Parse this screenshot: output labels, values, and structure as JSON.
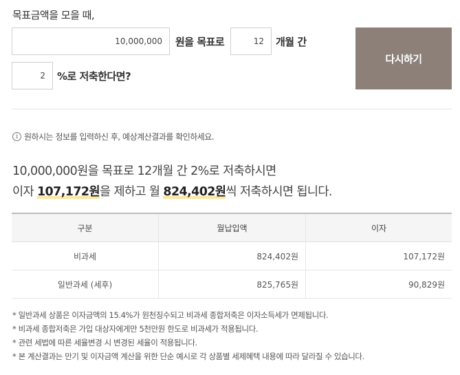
{
  "form": {
    "intro": "목표금액을 모을 때,",
    "amount_value": "10,000,000",
    "amount_suffix": "원을 목표로",
    "months_value": "12",
    "months_suffix": "개월 간",
    "rate_value": "2",
    "rate_suffix": "%로 저축한다면?",
    "recalc_label": "다시하기"
  },
  "notice": "원하시는 정보를 입력하신 후, 예상계산결과를 확인하세요.",
  "result": {
    "line1": "10,000,000원을 목표로 12개월 간 2%로 저축하시면",
    "line2_pre": "이자 ",
    "interest": "107,172원",
    "line2_mid": "을 제하고 월 ",
    "monthly": "824,402원",
    "line2_post": "씩 저축하시면 됩니다."
  },
  "table": {
    "headers": [
      "구분",
      "월납입액",
      "이자"
    ],
    "rows": [
      {
        "type": "비과세",
        "monthly": "824,402원",
        "interest": "107,172원"
      },
      {
        "type": "일반과세 (세후)",
        "monthly": "825,765원",
        "interest": "90,829원"
      }
    ]
  },
  "notes": [
    "* 일반과세 상품은 이자금액의 15.4%가 원천징수되고 비과세 종합저축은 이자소득세가 면제됩니다.",
    "* 비과세 종합저축은 가입 대상자에게만 5천만원 한도로 비과세가 적용됩니다.",
    "* 관련 세법에 따른 세율변경 시 변경된 세율이 적용됩니다.",
    "* 본 계산결과는 만기 및 이자금액 계산을 위한 단순 예시로 각 상품별 세제혜택 내용에 따라 달라질 수 있습니다."
  ],
  "colors": {
    "button": "#8c8079",
    "highlight": "#fbe7a1"
  },
  "icons": {
    "notice": "info-icon"
  }
}
